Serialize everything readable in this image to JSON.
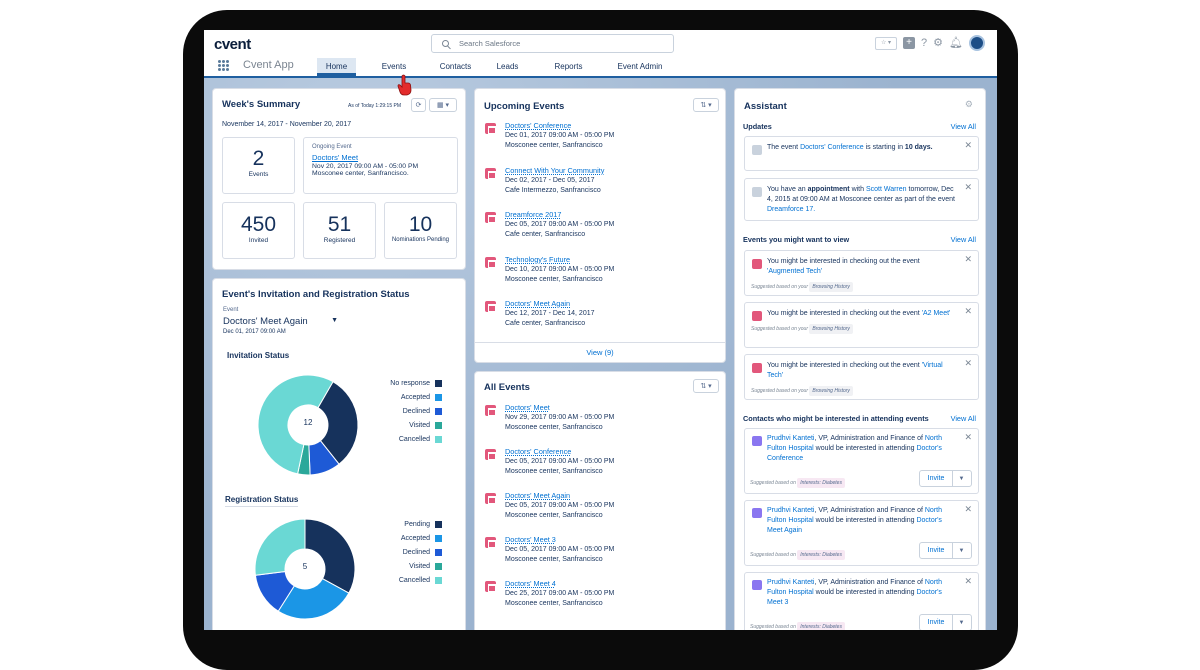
{
  "brand": {
    "logo": "cvent"
  },
  "header": {
    "search_placeholder": "Search Salesforce",
    "help_icon": "?"
  },
  "nav": {
    "app_name": "Cvent App",
    "tabs": [
      "Home",
      "Events",
      "Contacts",
      "Leads",
      "Reports",
      "Event Admin"
    ],
    "active_tab": "Home"
  },
  "summary": {
    "title": "Week's Summary",
    "as_of": "As of Today 1:29:15 PM",
    "date_range": "November 14, 2017 - November 20, 2017",
    "events_count": "2",
    "events_label": "Events",
    "ongoing_label": "Ongoing Event",
    "ongoing_name": "Doctors' Meet",
    "ongoing_date": "Nov 20, 2017 09:00 AM - 05:00 PM",
    "ongoing_place": "Mosconee center, Sanfrancisco.",
    "invited": "450",
    "invited_label": "Invited",
    "registered": "51",
    "registered_label": "Registered",
    "pending": "10",
    "pending_label": "Nominations Pending"
  },
  "status": {
    "title": "Event's Invitation and Registration Status",
    "event_label": "Event",
    "event_name": "Doctors' Meet Again",
    "event_date": "Dec 01, 2017 09:00 AM",
    "invitation_title": "Invitation Status",
    "invitation_center": "12",
    "invitation_legend": [
      {
        "label": "No response",
        "color": "#16325c"
      },
      {
        "label": "Accepted",
        "color": "#1b96e6"
      },
      {
        "label": "Declined",
        "color": "#1e5ad6"
      },
      {
        "label": "Visited",
        "color": "#2ba89a"
      },
      {
        "label": "Cancelled",
        "color": "#6ad8d4"
      }
    ],
    "invitation_values": [
      31,
      0,
      10,
      4,
      55
    ],
    "registration_title": "Registration Status",
    "registration_center": "5",
    "registration_legend": [
      {
        "label": "Pending",
        "color": "#16325c"
      },
      {
        "label": "Accepted",
        "color": "#1b96e6"
      },
      {
        "label": "Declined",
        "color": "#1e5ad6"
      },
      {
        "label": "Visited",
        "color": "#2ba89a"
      },
      {
        "label": "Cancelled",
        "color": "#6ad8d4"
      }
    ],
    "registration_values": [
      33,
      26,
      14,
      0,
      27
    ]
  },
  "upcoming": {
    "title": "Upcoming Events",
    "view_label": "View  (9)",
    "events": [
      {
        "name": "Doctors' Conference",
        "date": "Dec 01, 2017 09:00 AM - 05:00 PM",
        "place": "Mosconee center, Sanfrancisco"
      },
      {
        "name": "Connect With Your Community",
        "date": "Dec 02, 2017 - Dec 05, 2017",
        "place": "Cafe Intermezzo, Sanfrancisco"
      },
      {
        "name": "Dreamforce 2017",
        "date": "Dec 05, 2017 09:00 AM - 05:00 PM",
        "place": "Cafe center, Sanfrancisco"
      },
      {
        "name": "Technology's Future",
        "date": "Dec 10, 2017 09:00 AM - 05:00 PM",
        "place": "Mosconee center, Sanfrancisco"
      },
      {
        "name": "Doctors' Meet Again",
        "date": "Dec 12, 2017 - Dec 14, 2017",
        "place": "Cafe center, Sanfrancisco"
      }
    ]
  },
  "all_events": {
    "title": "All Events",
    "events": [
      {
        "name": "Doctors' Meet",
        "date": "Nov 29, 2017 09:00 AM - 05:00 PM",
        "place": "Mosconee center, Sanfrancisco"
      },
      {
        "name": "Doctors' Conference",
        "date": "Dec 05, 2017 09:00 AM - 05:00 PM",
        "place": "Mosconee center, Sanfrancisco"
      },
      {
        "name": "Doctors' Meet Again",
        "date": "Dec 05, 2017 09:00 AM - 05:00 PM",
        "place": "Mosconee center, Sanfrancisco"
      },
      {
        "name": "Doctors' Meet 3",
        "date": "Dec 05, 2017 09:00 AM - 05:00 PM",
        "place": "Mosconee center, Sanfrancisco"
      },
      {
        "name": "Doctors' Meet 4",
        "date": "Dec 25, 2017 09:00 AM - 05:00 PM",
        "place": "Mosconee center, Sanfrancisco"
      }
    ]
  },
  "assistant": {
    "title": "Assistant",
    "updates_label": "Updates",
    "view_all": "View All",
    "update1_pre": "The event ",
    "update1_link": "Doctors' Conference",
    "update1_mid": " is starting in ",
    "update1_bold": "10 days.",
    "update2_pre": "You have an ",
    "update2_bold": "appointment",
    "update2_mid": " with ",
    "update2_link": "Scott Warren",
    "update2_post": " tomorrow, Dec 4, 2015 at 09:00 AM at Mosconee center as part of the event ",
    "update2_link2": "Dreamforce 17.",
    "events_view_label": "Events you might want to view",
    "view_pre": "You might be interested in checking out the event ",
    "view_events": [
      "'Augmented Tech'",
      "'A2 Meet'",
      "'Virtual Tech'"
    ],
    "suggested_label": "Suggested based on your",
    "browsing_tag": "Browsing History",
    "contacts_label": "Contacts who might be interested in attending events",
    "contact_name": "Prudhvi Kanteti",
    "contact_role": ", VP, Administration and Finance of ",
    "contact_org": "North Fulton Hospital",
    "contact_mid": " would be interested in attending ",
    "contact_events": [
      "Doctor's Conference",
      "Doctor's Meet Again",
      "Doctor's  Meet 3"
    ],
    "suggested_based_on": "Suggested based on",
    "interest_tag": "Interests: Diabetes",
    "invite_label": "Invite"
  }
}
